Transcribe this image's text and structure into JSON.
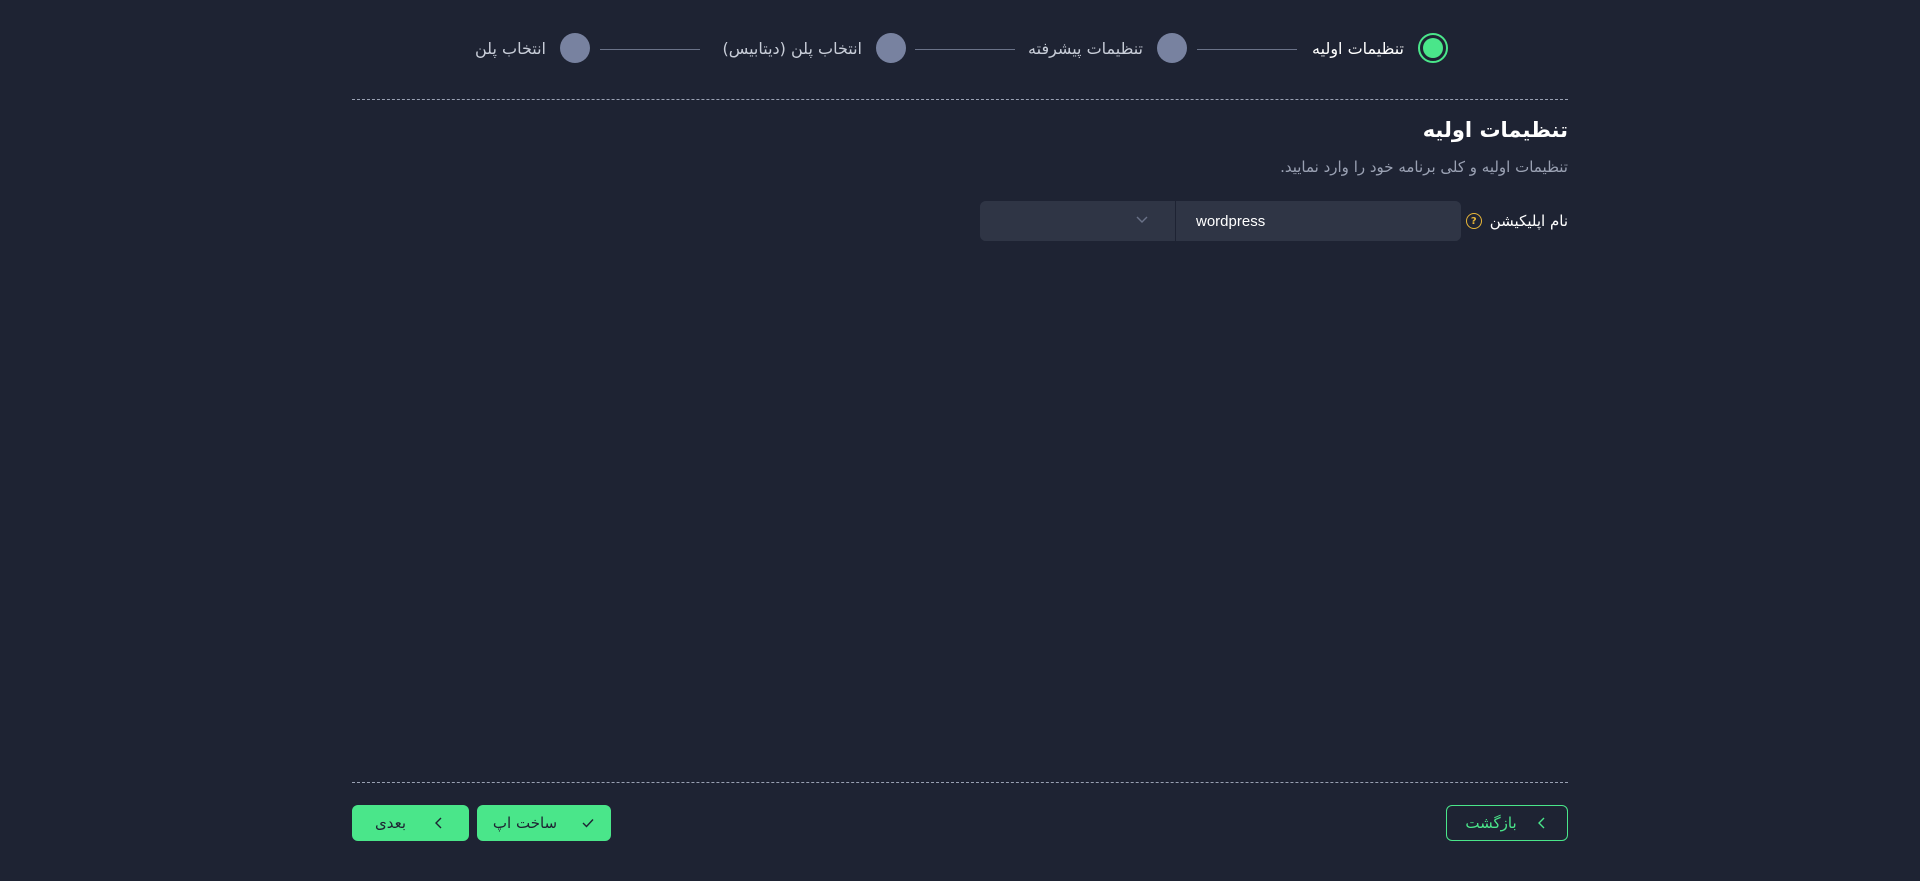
{
  "stepper": {
    "steps": [
      {
        "label": "تنظیمات اولیه",
        "state": "active"
      },
      {
        "label": "تنظیمات پیشرفته",
        "state": "inactive"
      },
      {
        "label": "انتخاب پلن (دیتابیس)",
        "state": "inactive"
      },
      {
        "label": "انتخاب پلن",
        "state": "inactive"
      }
    ]
  },
  "section": {
    "title": "تنظیمات اولیه",
    "subtitle": "تنظیمات اولیه و کلی برنامه خود را وارد نمایید."
  },
  "app_name_field": {
    "label": "نام اپلیکیشن",
    "value": "wordpress",
    "help_icon": "question-circle-icon",
    "select_value": ""
  },
  "footer": {
    "back_label": "بازگشت",
    "build_label": "ساخت اپ",
    "next_label": "بعدی"
  },
  "colors": {
    "background": "#1e2333",
    "accent": "#4ae68a",
    "step_inactive": "#7882a0",
    "input_bg": "#2f3545",
    "help_icon": "#e8b638"
  }
}
